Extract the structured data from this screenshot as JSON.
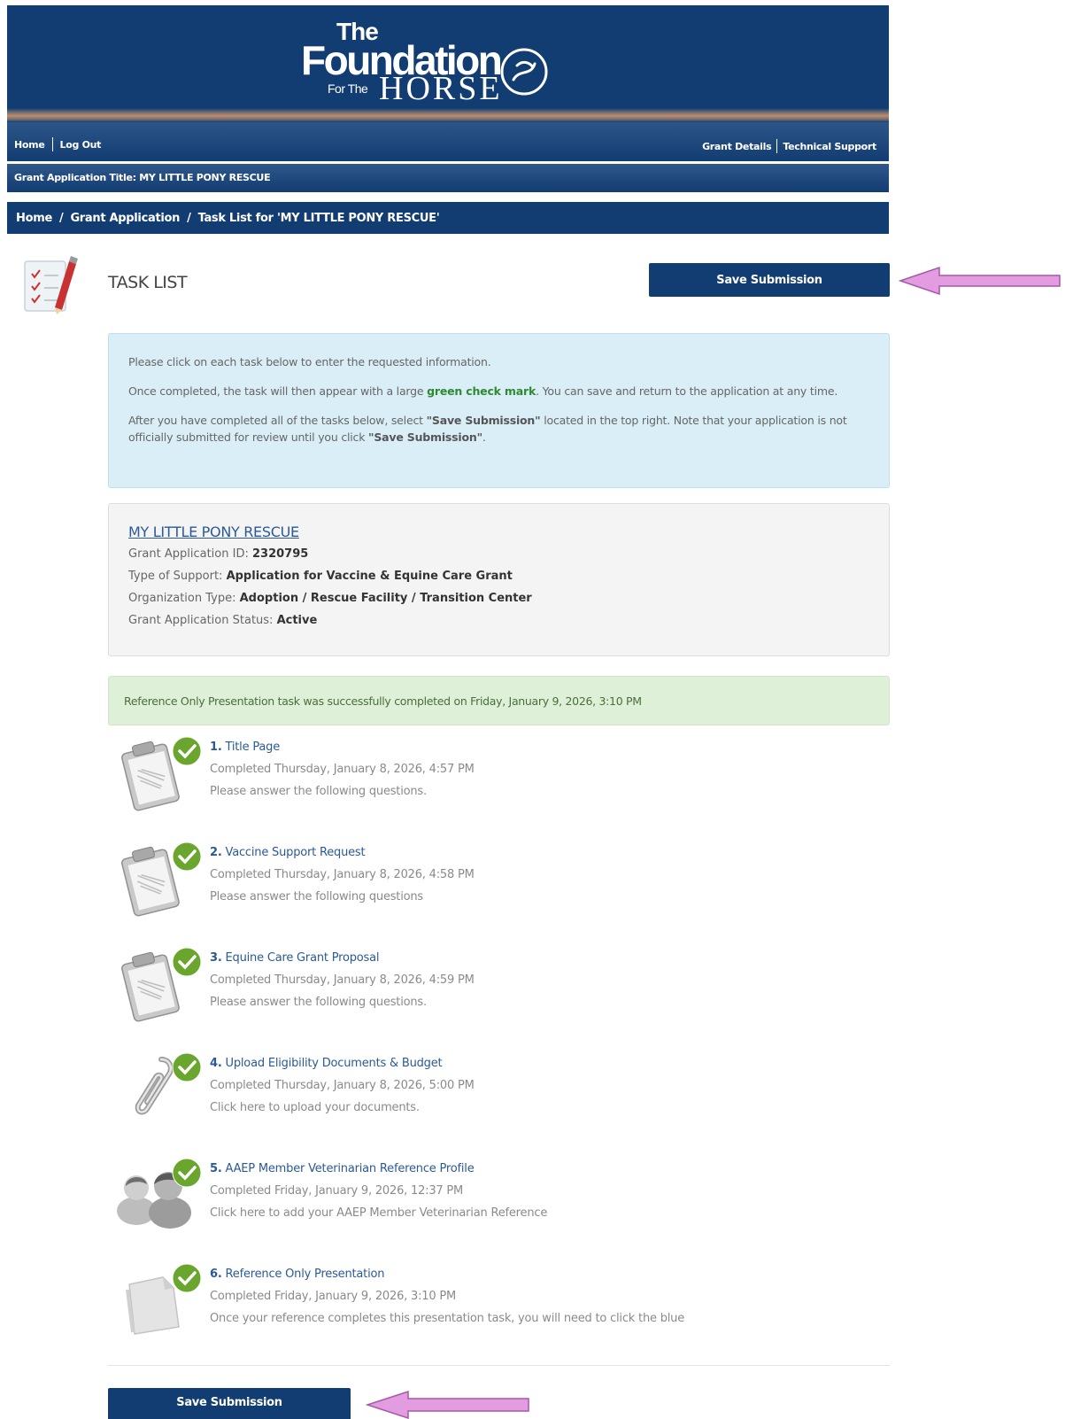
{
  "header": {
    "logo": {
      "the": "The",
      "foundation": "Foundation",
      "for_the": "For The",
      "horse": "HORSE"
    },
    "colors": {
      "navy": "#123d72",
      "accent_arrow": "#e49ce0",
      "check_green": "#6aa62e"
    }
  },
  "nav": {
    "home": "Home",
    "logout": "Log Out",
    "grant_details": "Grant Details",
    "technical_support": "Technical Support",
    "grant_title_label": "Grant Application Title:",
    "grant_title_value": "MY LITTLE PONY RESCUE"
  },
  "breadcrumb": {
    "items": [
      "Home",
      "Grant Application",
      "Task List for 'MY LITTLE PONY RESCUE'"
    ],
    "separator": "/"
  },
  "task_list": {
    "title": "TASK LIST",
    "save_label": "Save Submission"
  },
  "info": {
    "p1": "Please click on each task below to enter the requested information.",
    "p2_a": "Once completed, the task will then appear with a large ",
    "p2_green": "green check mark",
    "p2_b": ". You can save and return to the application at any time.",
    "p3_a": "After you have completed all of the tasks below, select ",
    "p3_b1": "\"Save Submission\"",
    "p3_c": "  located in the top right. Note that your application is not officially submitted for review until you click ",
    "p3_b2": "\"Save Submission\"",
    "p3_d": "."
  },
  "summary": {
    "title": "MY LITTLE PONY RESCUE",
    "id_label": "Grant Application ID: ",
    "id_value": "2320795",
    "support_label": "Type of Support: ",
    "support_value": "Application for Vaccine & Equine Care Grant",
    "org_label": "Organization Type: ",
    "org_value": "Adoption / Rescue Facility / Transition Center",
    "status_label": "Grant Application Status: ",
    "status_value": "Active"
  },
  "success_message": "Reference Only Presentation task was successfully completed on Friday, January 9, 2026, 3:10 PM",
  "tasks": [
    {
      "num": "1.",
      "title": "Title Page",
      "completed": "Completed Thursday, January 8, 2026, 4:57 PM",
      "desc": "Please answer the following questions.",
      "icon": "clipboard-icon"
    },
    {
      "num": "2.",
      "title": "Vaccine Support Request",
      "completed": "Completed Thursday, January 8, 2026, 4:58 PM",
      "desc": "Please answer the following questions",
      "icon": "clipboard-icon"
    },
    {
      "num": "3.",
      "title": "Equine Care Grant Proposal",
      "completed": "Completed Thursday, January 8, 2026, 4:59 PM",
      "desc": "Please answer the following questions.",
      "icon": "clipboard-icon"
    },
    {
      "num": "4.",
      "title": "Upload Eligibility Documents & Budget",
      "completed": "Completed Thursday, January 8, 2026, 5:00 PM",
      "desc": "Click here to upload your documents.",
      "icon": "paperclip-icon"
    },
    {
      "num": "5.",
      "title": "AAEP Member Veterinarian Reference Profile",
      "completed": "Completed Friday, January 9, 2026, 12:37 PM",
      "desc": "Click here to add your AAEP Member Veterinarian Reference",
      "icon": "people-icon"
    },
    {
      "num": "6.",
      "title": "Reference Only Presentation",
      "completed": "Completed Friday, January 9, 2026, 3:10 PM",
      "desc": "Once your reference completes this presentation task, you will need to click the blue",
      "icon": "document-icon"
    }
  ],
  "footer": {
    "save_label": "Save Submission"
  }
}
